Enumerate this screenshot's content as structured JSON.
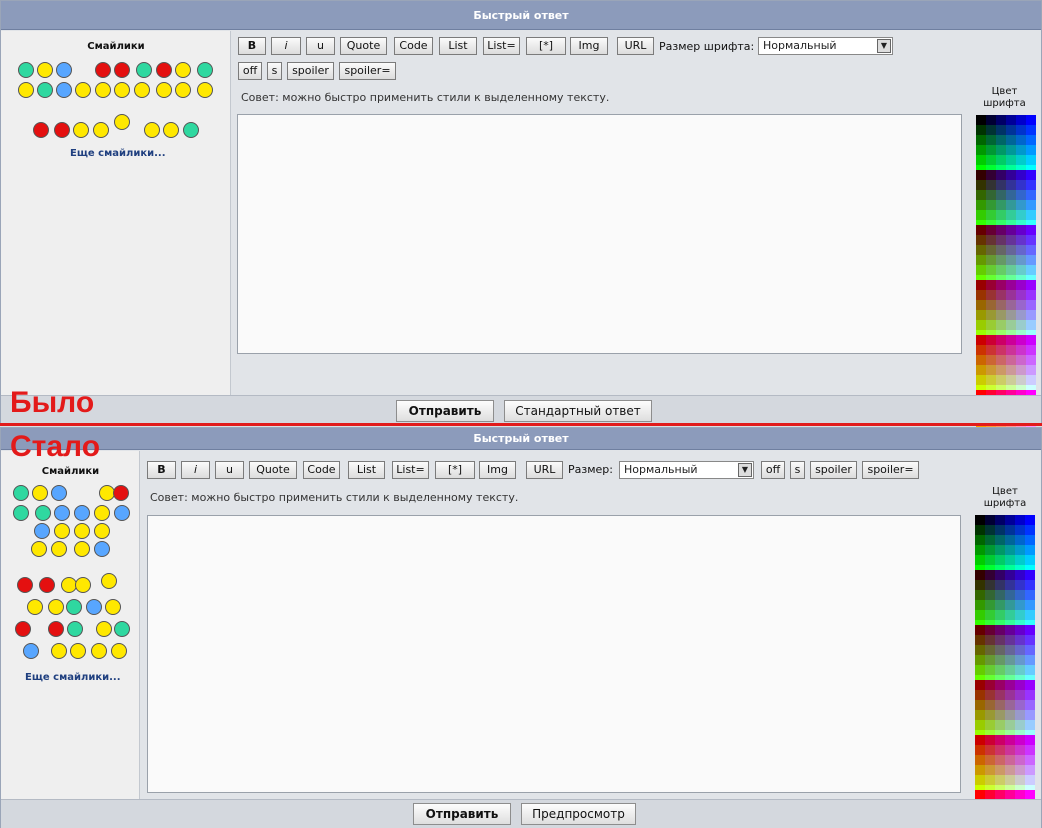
{
  "before": {
    "header": "Быстрый ответ",
    "smilies_title": "Смайлики",
    "more_smilies": "Еще смайлики...",
    "toolbar": [
      "B",
      "i",
      "u",
      "Quote",
      "Code",
      "List",
      "List=",
      "[*]",
      "Img",
      "URL"
    ],
    "font_size_label": "Размер шрифта:",
    "font_size_value": "Нормальный",
    "toolbar2": [
      "off",
      "s",
      "spoiler",
      "spoiler="
    ],
    "hint": "Совет: можно быстро применить стили к выделенному тексту.",
    "palette_title_1": "Цвет",
    "palette_title_2": "шрифта",
    "submit": "Отправить",
    "secondary": "Стандартный ответ"
  },
  "after": {
    "header": "Быстрый ответ",
    "smilies_title": "Смайлики",
    "more_smilies": "Еще смайлики...",
    "toolbar": [
      "B",
      "i",
      "u",
      "Quote",
      "Code",
      "List",
      "List=",
      "[*]",
      "Img",
      "URL"
    ],
    "font_size_label": "Размер:",
    "font_size_value": "Нормальный",
    "toolbar2": [
      "off",
      "s",
      "spoiler",
      "spoiler="
    ],
    "hint": "Совет: можно быстро применить стили к выделенному тексту.",
    "palette_title_1": "Цвет",
    "palette_title_2": "шрифта",
    "submit": "Отправить",
    "secondary": "Предпросмотр"
  },
  "overlay": {
    "before_label": "Было",
    "after_label": "Стало",
    "divider_color": "#e21b1b"
  },
  "colors": {
    "header_bg": "#8c9bbb",
    "smiley_yellow": "#ffe800",
    "smiley_green": "#2fd8a0",
    "smiley_red": "#e41010",
    "smiley_blue": "#58a6ff"
  }
}
